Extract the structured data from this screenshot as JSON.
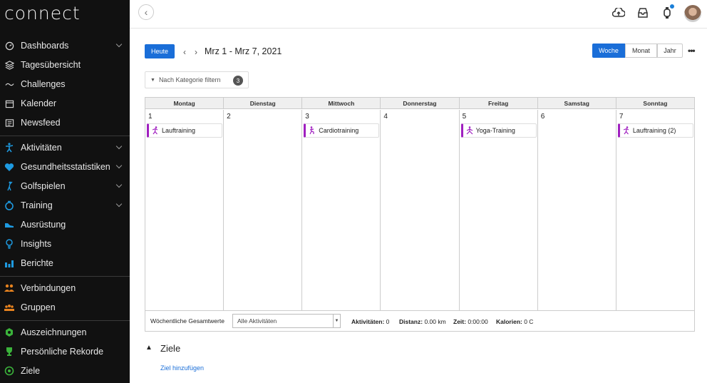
{
  "app": {
    "logo_text": "connect"
  },
  "sidebar": {
    "items": [
      {
        "label": "Dashboards",
        "icon": "gauge-icon",
        "has_chevron": true
      },
      {
        "label": "Tagesübersicht",
        "icon": "layers-icon",
        "has_chevron": false
      },
      {
        "label": "Challenges",
        "icon": "wave-icon",
        "has_chevron": false
      },
      {
        "label": "Kalender",
        "icon": "calendar-icon",
        "has_chevron": false
      },
      {
        "label": "Newsfeed",
        "icon": "newspaper-icon",
        "has_chevron": false
      },
      {
        "label": "Aktivitäten",
        "icon": "running-person-icon",
        "has_chevron": true
      },
      {
        "label": "Gesundheitsstatistiken",
        "icon": "heart-icon",
        "has_chevron": true
      },
      {
        "label": "Golfspielen",
        "icon": "golfer-icon",
        "has_chevron": true
      },
      {
        "label": "Training",
        "icon": "stopwatch-icon",
        "has_chevron": true
      },
      {
        "label": "Ausrüstung",
        "icon": "shoe-icon",
        "has_chevron": false
      },
      {
        "label": "Insights",
        "icon": "lightbulb-icon",
        "has_chevron": false
      },
      {
        "label": "Berichte",
        "icon": "bar-chart-icon",
        "has_chevron": false
      },
      {
        "label": "Verbindungen",
        "icon": "people-icon",
        "has_chevron": false
      },
      {
        "label": "Gruppen",
        "icon": "group-icon",
        "has_chevron": false
      },
      {
        "label": "Auszeichnungen",
        "icon": "badge-icon",
        "has_chevron": false
      },
      {
        "label": "Persönliche Rekorde",
        "icon": "trophy-icon",
        "has_chevron": false
      },
      {
        "label": "Ziele",
        "icon": "target-icon",
        "has_chevron": false
      }
    ]
  },
  "toolbar": {
    "today_label": "Heute",
    "date_range": "Mrz 1 - Mrz 7, 2021",
    "views": [
      "Woche",
      "Monat",
      "Jahr"
    ],
    "active_view": "Woche",
    "more_label": "•••"
  },
  "filter": {
    "label": "Nach Kategorie filtern",
    "count": "3"
  },
  "calendar": {
    "weekdays": [
      "Montag",
      "Dienstag",
      "Mittwoch",
      "Donnerstag",
      "Freitag",
      "Samstag",
      "Sonntag"
    ],
    "days": [
      {
        "num": "1",
        "event": "Lauftraining",
        "event_icon": "running-icon"
      },
      {
        "num": "2",
        "event": null
      },
      {
        "num": "3",
        "event": "Cardiotraining",
        "event_icon": "cardio-icon"
      },
      {
        "num": "4",
        "event": null
      },
      {
        "num": "5",
        "event": "Yoga-Training",
        "event_icon": "yoga-icon"
      },
      {
        "num": "6",
        "event": null
      },
      {
        "num": "7",
        "event": "Lauftraining (2)",
        "event_icon": "running-icon"
      }
    ],
    "event_color": "#a020c0"
  },
  "weekly_totals": {
    "label": "Wöchentliche Gesamtwerte",
    "select_value": "Alle Aktivitäten",
    "activities_label": "Aktivitäten:",
    "activities_value": "0",
    "distance_label": "Distanz:",
    "distance_value": "0.00 km",
    "time_label": "Zeit:",
    "time_value": "0:00:00",
    "calories_label": "Kalorien:",
    "calories_value": "0 C"
  },
  "goals": {
    "title": "Ziele",
    "add_link": "Ziel hinzufügen"
  },
  "colors": {
    "accent": "#1a6ed8",
    "sidebar_bg": "#111111"
  }
}
